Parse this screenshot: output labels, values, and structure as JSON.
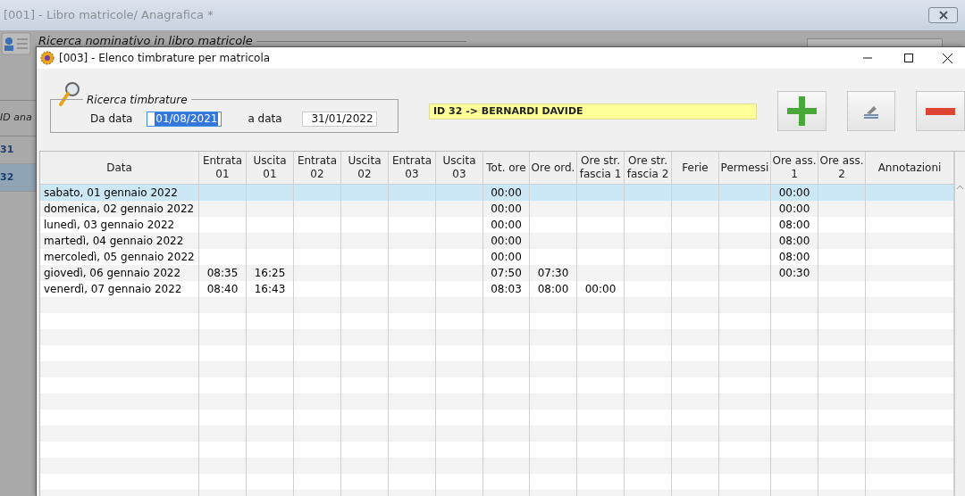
{
  "back_window": {
    "title": "[001] - Libro matricole/ Anagrafica *",
    "search_group": "Ricerca nominativo in libro matricole",
    "id_column": "ID ana",
    "rows": [
      {
        "id": "31",
        "selected": false
      },
      {
        "id": "32",
        "selected": true
      }
    ]
  },
  "dialog": {
    "title": "[003] - Elenco timbrature per matricola",
    "search": {
      "legend": "Ricerca timbrature",
      "from_label": "Da data",
      "from_value": "01/08/2021",
      "to_label": "a data",
      "to_value": "31/01/2022"
    },
    "employee": "ID 32 -> BERNARDI DAVIDE",
    "table": {
      "columns": [
        "Data",
        "Entrata\n01",
        "Uscita\n01",
        "Entrata\n02",
        "Uscita\n02",
        "Entrata\n03",
        "Uscita\n03",
        "Tot. ore",
        "Ore ord.",
        "Ore str.\nfascia 1",
        "Ore str.\nfascia 2",
        "Ferie",
        "Permessi",
        "Ore ass.\n1",
        "Ore ass.\n2",
        "Annotazioni"
      ],
      "rows": [
        {
          "selected": true,
          "cells": [
            "sabato, 01 gennaio 2022",
            null,
            null,
            null,
            null,
            null,
            null,
            "00:00",
            null,
            null,
            null,
            null,
            null,
            "00:00",
            null,
            null
          ]
        },
        {
          "selected": false,
          "cells": [
            "domenica, 02 gennaio 2022",
            null,
            null,
            null,
            null,
            null,
            null,
            "00:00",
            null,
            null,
            null,
            null,
            null,
            "00:00",
            null,
            null
          ]
        },
        {
          "selected": false,
          "cells": [
            "lunedì, 03 gennaio 2022",
            null,
            null,
            null,
            null,
            null,
            null,
            "00:00",
            null,
            null,
            null,
            null,
            null,
            "08:00",
            null,
            null
          ]
        },
        {
          "selected": false,
          "cells": [
            "martedì, 04 gennaio 2022",
            null,
            null,
            null,
            null,
            null,
            null,
            "00:00",
            null,
            null,
            null,
            null,
            null,
            "08:00",
            null,
            null
          ]
        },
        {
          "selected": false,
          "cells": [
            "mercoledì, 05 gennaio 2022",
            null,
            null,
            null,
            null,
            null,
            null,
            "00:00",
            null,
            null,
            null,
            null,
            null,
            "08:00",
            null,
            null
          ]
        },
        {
          "selected": false,
          "cells": [
            "giovedì, 06 gennaio 2022",
            "08:35",
            "16:25",
            null,
            null,
            null,
            null,
            "07:50",
            "07:30",
            null,
            null,
            null,
            null,
            "00:30",
            null,
            null
          ]
        },
        {
          "selected": false,
          "cells": [
            "venerdì, 07 gennaio 2022",
            "08:40",
            "16:43",
            null,
            null,
            null,
            null,
            "08:03",
            "08:00",
            "00:00",
            null,
            null,
            null,
            null,
            null,
            null
          ]
        }
      ]
    }
  }
}
